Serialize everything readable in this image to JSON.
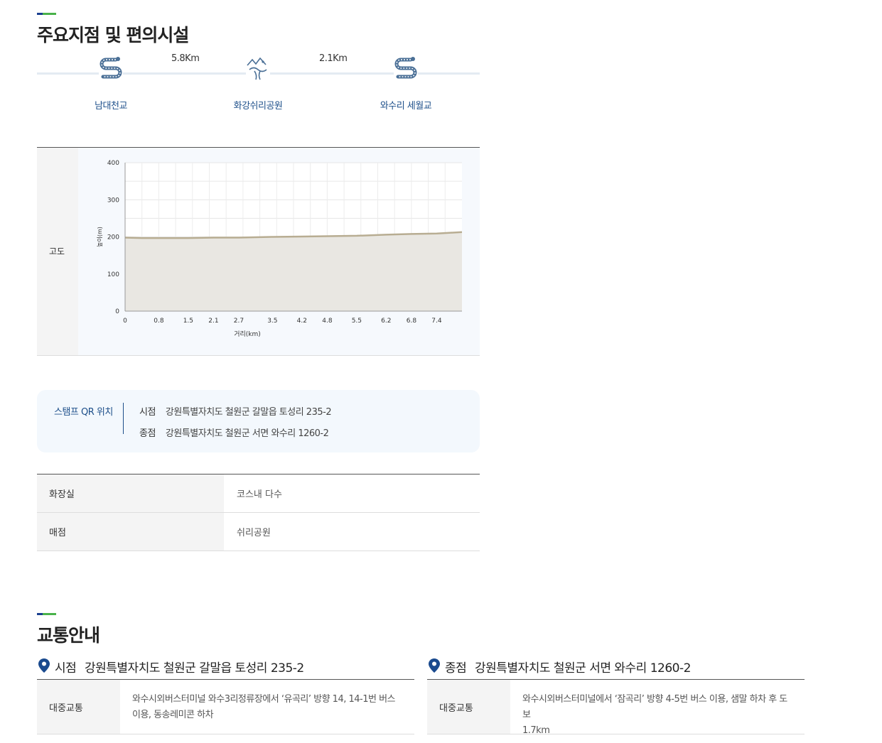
{
  "sections": {
    "points_title": "주요지점 및 편의시설",
    "transport_title": "교통안내"
  },
  "colors": {
    "accent_blue": "#1a3f8f",
    "accent_green": "#49b24a",
    "link_blue": "#1d4f8a"
  },
  "points": [
    {
      "name": "남대천교",
      "icon": "winding-road-icon"
    },
    {
      "name": "화강쉬리공원",
      "icon": "fish-park-icon"
    },
    {
      "name": "와수리 세월교",
      "icon": "winding-road-icon"
    }
  ],
  "distances": [
    "5.8Km",
    "2.1Km"
  ],
  "altitude": {
    "label": "고도"
  },
  "chart_data": {
    "type": "area",
    "xlabel": "거리(km)",
    "ylabel": "높이(m)",
    "ylim": [
      0,
      400
    ],
    "xlim": [
      0,
      8.0
    ],
    "y_ticks": [
      0,
      100,
      200,
      300,
      400
    ],
    "x_ticks": [
      "0",
      "0.8",
      "1.5",
      "2.1",
      "2.7",
      "3.5",
      "4.2",
      "4.8",
      "5.5",
      "6.2",
      "6.8",
      "7.4"
    ],
    "x_tick_values": [
      0,
      0.8,
      1.5,
      2.1,
      2.7,
      3.5,
      4.2,
      4.8,
      5.5,
      6.2,
      6.8,
      7.4
    ],
    "grid": true,
    "series": [
      {
        "x": [
          0,
          0.4,
          0.8,
          1.5,
          2.1,
          2.7,
          3.5,
          4.2,
          4.8,
          5.5,
          6.2,
          6.8,
          7.4,
          7.7,
          8.0
        ],
        "values": [
          198,
          197,
          197,
          197,
          198,
          198,
          200,
          201,
          202,
          203,
          206,
          208,
          209,
          211,
          213
        ]
      }
    ]
  },
  "stamp": {
    "label": "스탬프 QR 위치",
    "start_key": "시점",
    "start_value": "강원특별자치도 철원군 갈말읍 토성리 235-2",
    "end_key": "종점",
    "end_value": "강원특별자치도 철원군 서면 와수리 1260-2"
  },
  "facilities": [
    {
      "key": "화장실",
      "value": "코스내 다수"
    },
    {
      "key": "매점",
      "value": "쉬리공원"
    }
  ],
  "transport": {
    "start": {
      "label": "시점",
      "address": "강원특별자치도 철원군 갈말읍 토성리 235-2",
      "key": "대중교통",
      "line1": "와수시외버스터미널 와수3리정류장에서 ‘유곡리’ 방향 14, 14-1번 버스",
      "line2": "이용, 동송레미콘 하차"
    },
    "end": {
      "label": "종점",
      "address": "강원특별자치도 철원군 서면 와수리 1260-2",
      "key": "대중교통",
      "line1": "와수시외버스터미널에서 ‘잠곡리’ 방향 4-5번 버스 이용, 샘말 하차 후 도보",
      "line2": "1.7km"
    }
  }
}
